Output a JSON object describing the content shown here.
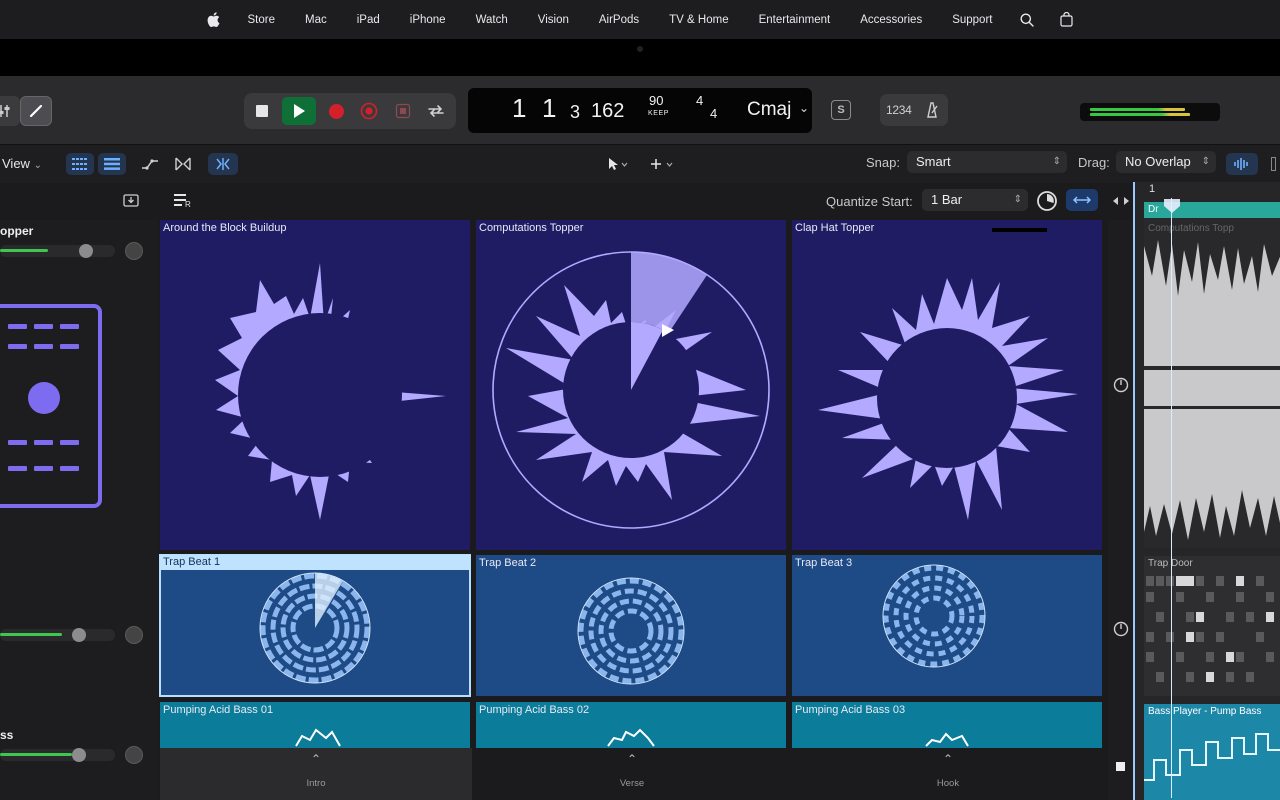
{
  "nav": {
    "items": [
      "Store",
      "Mac",
      "iPad",
      "iPhone",
      "Watch",
      "Vision",
      "AirPods",
      "TV & Home",
      "Entertainment",
      "Accessories",
      "Support"
    ],
    "icons": [
      "apple-logo-icon",
      "search-icon",
      "bag-icon"
    ]
  },
  "lcd": {
    "bar": "1",
    "beat": "1",
    "division": "3",
    "tick": "162",
    "tempo": "90",
    "tempo_mode": "KEEP",
    "sig_top": "4",
    "sig_bottom": "4",
    "key": "Cmaj"
  },
  "control_bar": {
    "count_in": "1234",
    "score_button": "S"
  },
  "toolbar": {
    "view_label": "View",
    "snap_label": "Snap:",
    "snap_value": "Smart",
    "drag_label": "Drag:",
    "drag_value": "No Overlap"
  },
  "row2": {
    "quantize_label": "Quantize Start:",
    "quantize_value": "1 Bar"
  },
  "tracks": [
    {
      "name": "opper"
    },
    {
      "name": ""
    },
    {
      "name": "ss"
    }
  ],
  "cells": {
    "row1": [
      "Around the Block Buildup",
      "Computations Topper",
      "Clap Hat Topper"
    ],
    "row2": [
      "Trap Beat 1",
      "Trap Beat 2",
      "Trap Beat 3"
    ],
    "row3": [
      "Pumping Acid Bass 01",
      "Pumping Acid Bass 02",
      "Pumping Acid Bass 03"
    ]
  },
  "scenes": [
    "Intro",
    "Verse",
    "Hook"
  ],
  "tracks_area": {
    "ruler_bar": "1",
    "region1_label": "Dr",
    "region1_sub": "Computations Topp",
    "region2_label": "Trap Door",
    "region3_label": "Bass Player - Pump Bass"
  },
  "colors": {
    "accent_purple": "#7e6cf0",
    "cell_purple": "#1f1c64",
    "cell_blue": "#1e4a86",
    "cell_teal": "#0b7c99",
    "waveform": "#b3a9ff",
    "play_green": "#0e6f37",
    "record_red": "#d3202b"
  }
}
